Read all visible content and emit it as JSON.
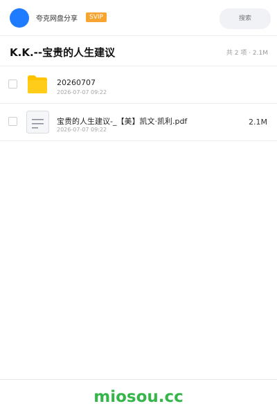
{
  "header": {
    "user_name": "夸克网盘分享",
    "badge": "SVIP",
    "search_placeholder": "搜索"
  },
  "folder": {
    "title": "K.K.--宝贵的人生建议",
    "summary": "共 2 项 · 2.1M"
  },
  "files": [
    {
      "icon": "folder-icon",
      "name": "20260707",
      "date": "2026-07-07 09:22",
      "size": ""
    },
    {
      "icon": "document-icon",
      "name": "宝贵的人生建议-_【美】凯文·凯利.pdf",
      "date": "2026-07-07 09:22",
      "size": "2.1M"
    }
  ],
  "footer": {
    "watermark": "miosou.cc"
  },
  "colors": {
    "accent_blue": "#1f7bff",
    "svip_orange": "#f7a531",
    "folder_yellow": "#ffc300",
    "watermark_green": "#36b64a"
  }
}
